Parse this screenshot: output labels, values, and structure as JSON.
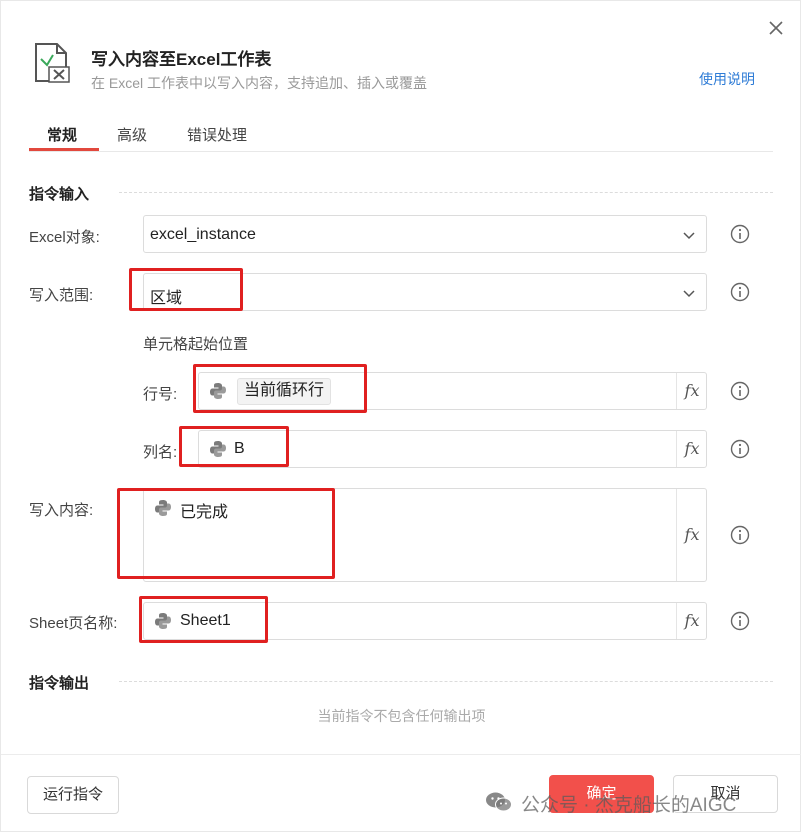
{
  "dialog": {
    "title": "写入内容至Excel工作表",
    "subtitle": "在 Excel 工作表中以写入内容，支持追加、插入或覆盖",
    "help_link": "使用说明",
    "icons": {
      "close": "close-icon",
      "header": "excel-icon"
    }
  },
  "tabs": [
    {
      "label": "常规",
      "active": true
    },
    {
      "label": "高级",
      "active": false
    },
    {
      "label": "错误处理",
      "active": false
    }
  ],
  "input_section": {
    "title": "指令输入",
    "excel_object": {
      "label": "Excel对象:",
      "value": "excel_instance"
    },
    "write_range": {
      "label": "写入范围:",
      "value": "区域"
    },
    "cell_start": {
      "title": "单元格起始位置",
      "row": {
        "label": "行号:",
        "value": "当前循环行"
      },
      "column": {
        "label": "列名:",
        "value": "B"
      }
    },
    "content": {
      "label": "写入内容:",
      "value": "已完成"
    },
    "sheet_name": {
      "label": "Sheet页名称:",
      "value": "Sheet1"
    }
  },
  "output_section": {
    "title": "指令输出",
    "empty_text": "当前指令不包含任何输出项"
  },
  "footer": {
    "run_label": "运行指令",
    "ok_label": "确定",
    "cancel_label": "取消"
  },
  "watermark": {
    "text": "公众号 · 杰克船长的AIGC"
  },
  "colors": {
    "accent": "#e2483d",
    "primary_button": "#f2504b",
    "link": "#2f7cd6",
    "highlight_box": "#e02020"
  }
}
